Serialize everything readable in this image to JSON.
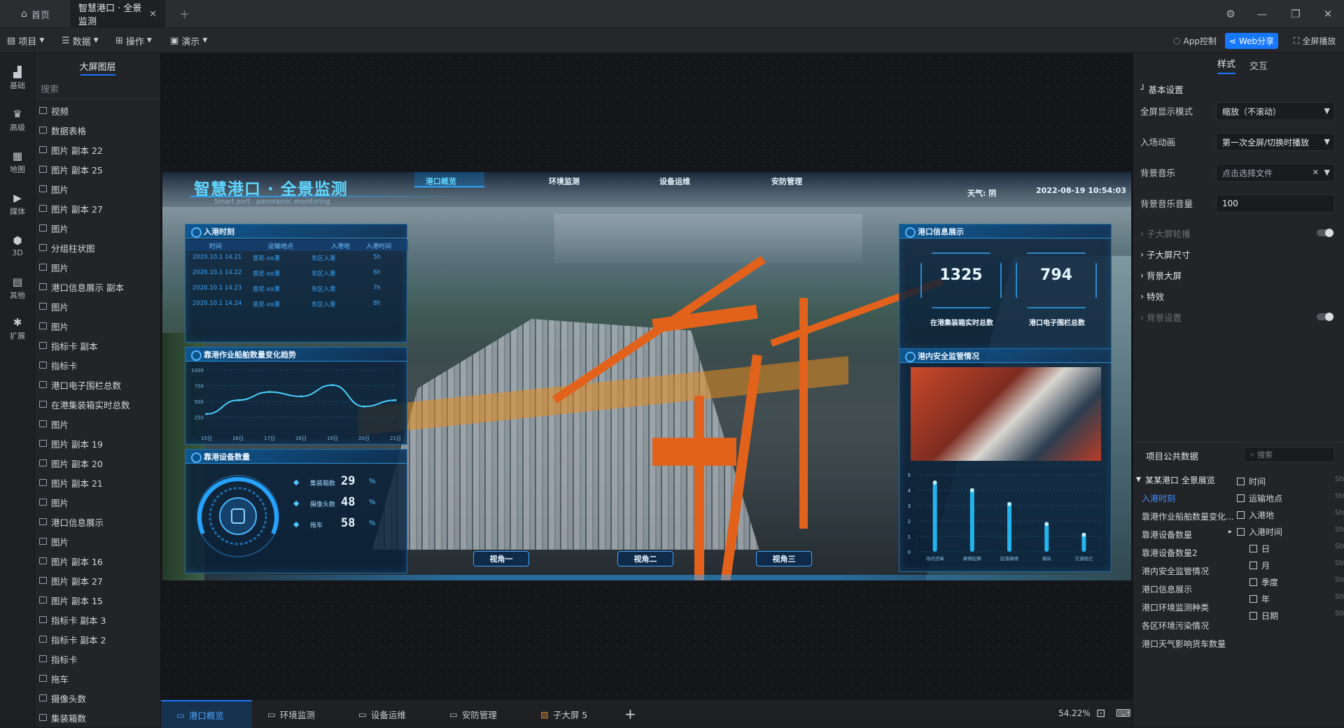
{
  "titlebar": {
    "home_tab": "首页",
    "active_tab": "智慧港口 · 全景监测",
    "new_tab": "+"
  },
  "menubar": {
    "menus": [
      "项目",
      "数据",
      "操作",
      "演示"
    ],
    "app_control": "App控制",
    "web_share": "Web分享",
    "fullscreen": "全屏播放"
  },
  "iconbar": {
    "items": [
      "基础",
      "高级",
      "地图",
      "媒体",
      "3D",
      "其他",
      "扩展"
    ]
  },
  "layers": {
    "title": "大屏图层",
    "search_placeholder": "搜索",
    "items": [
      {
        "label": "视频",
        "icon": "video-icon"
      },
      {
        "label": "数据表格",
        "icon": "table-icon"
      },
      {
        "label": "图片 副本 22",
        "icon": "image-icon"
      },
      {
        "label": "图片 副本 25",
        "icon": "image-icon"
      },
      {
        "label": "图片",
        "icon": "image-icon"
      },
      {
        "label": "图片 副本 27",
        "icon": "image-icon"
      },
      {
        "label": "图片",
        "icon": "image-icon"
      },
      {
        "label": "分组柱状图",
        "icon": "bar-chart-icon"
      },
      {
        "label": "图片",
        "icon": "image-icon"
      },
      {
        "label": "港口信息展示 副本",
        "icon": "text-icon"
      },
      {
        "label": "图片",
        "icon": "image-icon"
      },
      {
        "label": "图片",
        "icon": "image-icon"
      },
      {
        "label": "指标卡 副本",
        "icon": "number-icon"
      },
      {
        "label": "指标卡",
        "icon": "number-icon"
      },
      {
        "label": "港口电子围栏总数",
        "icon": "text-icon"
      },
      {
        "label": "在港集装箱实时总数",
        "icon": "text-icon"
      },
      {
        "label": "图片",
        "icon": "image-icon"
      },
      {
        "label": "图片 副本 19",
        "icon": "image-icon"
      },
      {
        "label": "图片 副本 20",
        "icon": "image-icon"
      },
      {
        "label": "图片 副本 21",
        "icon": "image-icon"
      },
      {
        "label": "图片",
        "icon": "image-icon"
      },
      {
        "label": "港口信息展示",
        "icon": "text-icon"
      },
      {
        "label": "图片",
        "icon": "image-icon"
      },
      {
        "label": "图片 副本 16",
        "icon": "image-icon"
      },
      {
        "label": "图片 副本 27",
        "icon": "image-icon"
      },
      {
        "label": "图片 副本 15",
        "icon": "image-icon"
      },
      {
        "label": "指标卡 副本 3",
        "icon": "number-icon"
      },
      {
        "label": "指标卡 副本 2",
        "icon": "number-icon"
      },
      {
        "label": "指标卡",
        "icon": "number-icon"
      },
      {
        "label": "拖车",
        "icon": "text-icon"
      },
      {
        "label": "摄像头数",
        "icon": "text-icon"
      },
      {
        "label": "集装箱数",
        "icon": "text-icon"
      }
    ]
  },
  "dashboard": {
    "title": "智慧港口 · 全景监测",
    "subtitle": "Smart port · panoramic monitoring",
    "nav": [
      "港口概览",
      "环境监测",
      "设备运维",
      "安防管理"
    ],
    "weather": "天气: 阴",
    "datetime": "2022-08-19 10:54:03",
    "entry_panel": {
      "title": "入港时刻",
      "headers": [
        "时间",
        "运输地点",
        "入港地",
        "入港时间"
      ],
      "rows": [
        [
          "2020.10.1 14.21",
          "恩尼-xx港",
          "东区入港",
          "5h"
        ],
        [
          "2020.10.1 14.22",
          "恩尼-xx港",
          "东区入港",
          "6h"
        ],
        [
          "2020.10.1 14.23",
          "恩尼-xx港",
          "东区入港",
          "7h"
        ],
        [
          "2020.10.1 14.24",
          "恩尼-xx港",
          "东区入港",
          "8h"
        ]
      ]
    },
    "ships_panel": {
      "title": "靠港作业船舶数量变化趋势"
    },
    "equip_panel": {
      "title": "靠港设备数量",
      "items": [
        {
          "label": "集装箱数",
          "value": "29",
          "unit": "%"
        },
        {
          "label": "摄像头数",
          "value": "48",
          "unit": "%"
        },
        {
          "label": "拖车",
          "value": "58",
          "unit": "%"
        }
      ]
    },
    "info_panel": {
      "title": "港口信息展示",
      "containers_value": "1325",
      "containers_label": "在港集装箱实时总数",
      "fence_value": "794",
      "fence_label": "港口电子围栏总数"
    },
    "safety_panel": {
      "title": "港内安全监管情况"
    },
    "views": [
      "视角一",
      "视角二",
      "视角三"
    ]
  },
  "chart_data": [
    {
      "type": "line",
      "title": "靠港作业船舶数量变化趋势",
      "x": [
        "15日",
        "16日",
        "17日",
        "18日",
        "19日",
        "20日",
        "21日"
      ],
      "ylim": [
        0,
        1000
      ],
      "yticks": [
        "1000",
        "750",
        "500",
        "250"
      ],
      "series": [
        {
          "values": [
            300,
            520,
            650,
            580,
            760,
            420,
            520
          ]
        }
      ]
    },
    {
      "type": "bar",
      "categories": [
        "场内违章",
        "摩擦起舞",
        "起落摩擦",
        "偶风",
        "交通阻拦"
      ],
      "ylim": [
        0,
        5
      ],
      "yticks": [
        "5",
        "4",
        "3",
        "2",
        "1",
        "0"
      ],
      "values": [
        4.5,
        4.0,
        3.1,
        1.8,
        1.1
      ]
    }
  ],
  "bottombar": {
    "tabs": [
      "港口概览",
      "环境监测",
      "设备运维",
      "安防管理",
      "子大屏 5"
    ],
    "add": "+",
    "zoom": "54.22%"
  },
  "rightpanel": {
    "tabs": [
      "样式",
      "交互"
    ],
    "basic_settings": "基本设置",
    "fullscreen_mode_label": "全屏显示模式",
    "fullscreen_mode_value": "缩放（不滚动）",
    "entry_anim_label": "入场动画",
    "entry_anim_value": "第一次全屏/切换时播放",
    "bgm_label": "背景音乐",
    "bgm_value": "点击选择文件",
    "bgm_volume_label": "背景音乐音量",
    "bgm_volume_value": "100",
    "sections": [
      "子大屏轮播",
      "子大屏尺寸",
      "背景大屏",
      "特效",
      "背景设置"
    ],
    "public_data_title": "项目公共数据",
    "public_search_placeholder": "搜索",
    "dataset_group": "某某港口 全景展览",
    "datasets": [
      "入港时刻",
      "靠港作业船舶数量变化...",
      "靠港设备数量",
      "靠港设备数量2",
      "港内安全监管情况",
      "港口信息展示",
      "港口环境监测种类",
      "各区环境污染情况",
      "港口天气影响货车数量"
    ],
    "fields": [
      "时间",
      "运输地点",
      "入港地",
      "入港时间",
      "日",
      "月",
      "季度",
      "年",
      "日期"
    ],
    "field_type": "Str"
  }
}
